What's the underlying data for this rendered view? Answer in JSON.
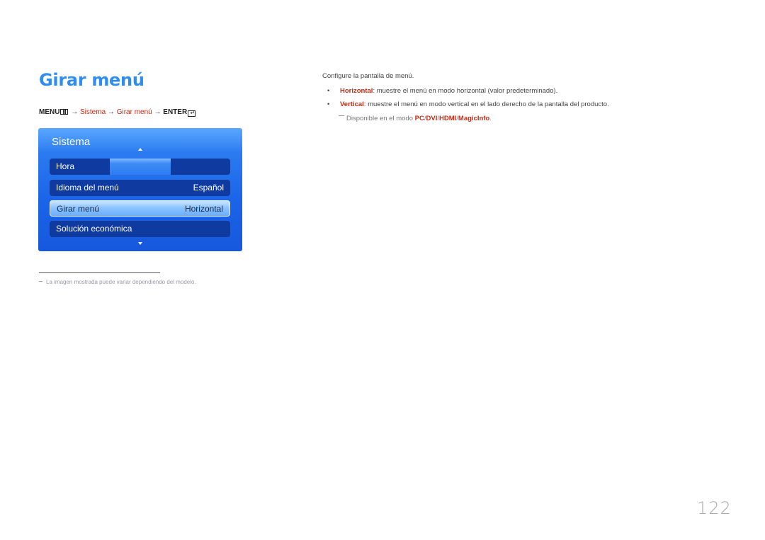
{
  "page": {
    "title": "Girar menú",
    "number": "122"
  },
  "breadcrumb": {
    "menu": "MENU",
    "arrow": "→",
    "step1": "Sistema",
    "step2": "Girar menú",
    "enter": "ENTER",
    "icons": [
      "menu-icon",
      "enter-icon"
    ]
  },
  "osd": {
    "title": "Sistema",
    "items": [
      {
        "label": "Hora",
        "value": ""
      },
      {
        "label": "Idioma del menú",
        "value": "Español"
      },
      {
        "label": "Girar menú",
        "value": "Horizontal",
        "selected": true
      },
      {
        "label": "Solución económica",
        "value": ""
      }
    ],
    "colors": {
      "panel": "#1a63e8",
      "item": "#0f3aa0",
      "selected": "#8cc4ff"
    }
  },
  "description": {
    "intro": "Configure la pantalla de menú.",
    "bullets": [
      {
        "term": "Horizontal",
        "text": ": muestre el menú en modo horizontal (valor predeterminado)."
      },
      {
        "term": "Vertical",
        "text": ": muestre el menú en modo vertical en el lado derecho de la pantalla del producto."
      }
    ],
    "note": {
      "prefix": "Disponible en el modo ",
      "modes": [
        "PC",
        "DVI",
        "HDMI",
        "MagicInfo"
      ],
      "sep": "/",
      "suffix": "."
    }
  },
  "footnote": "La imagen mostrada puede variar dependiendo del modelo.",
  "colors": {
    "title": "#2f8cf0",
    "accent_red": "#c62a12"
  }
}
